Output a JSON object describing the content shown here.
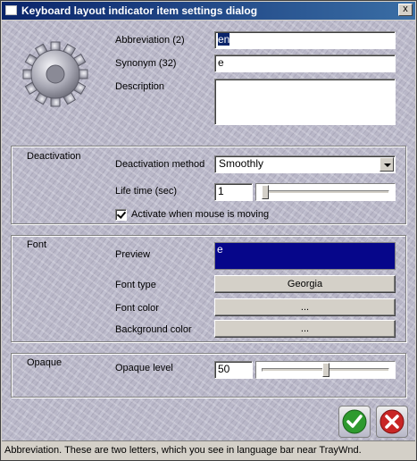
{
  "window": {
    "title": "Keyboard layout indicator item settings dialog",
    "close_glyph": "x"
  },
  "general": {
    "abbreviation_label": "Abbreviation (2)",
    "abbreviation_value": "en",
    "synonym_label": "Synonym (32)",
    "synonym_value": "e",
    "description_label": "Description",
    "description_value": ""
  },
  "deactivation": {
    "group_label": "Deactivation",
    "method_label": "Deactivation method",
    "method_value": "Smoothly",
    "lifetime_label": "Life time (sec)",
    "lifetime_value": "1",
    "activate_mouse_label": "Activate when mouse is moving",
    "activate_mouse_checked": true
  },
  "font": {
    "group_label": "Font",
    "preview_label": "Preview",
    "preview_text": "e",
    "preview_bg": "#06068a",
    "font_type_label": "Font type",
    "font_type_value": "Georgia",
    "font_color_label": "Font color",
    "font_color_value": "...",
    "bg_color_label": "Background color",
    "bg_color_value": "..."
  },
  "opaque": {
    "group_label": "Opaque",
    "level_label": "Opaque level",
    "level_value": "50"
  },
  "status": {
    "text": "Abbreviation. These are two letters, which you see in language bar near TrayWnd."
  },
  "icons": {
    "app": "gear-icon",
    "ok": "checkmark-icon",
    "cancel": "cross-icon"
  }
}
